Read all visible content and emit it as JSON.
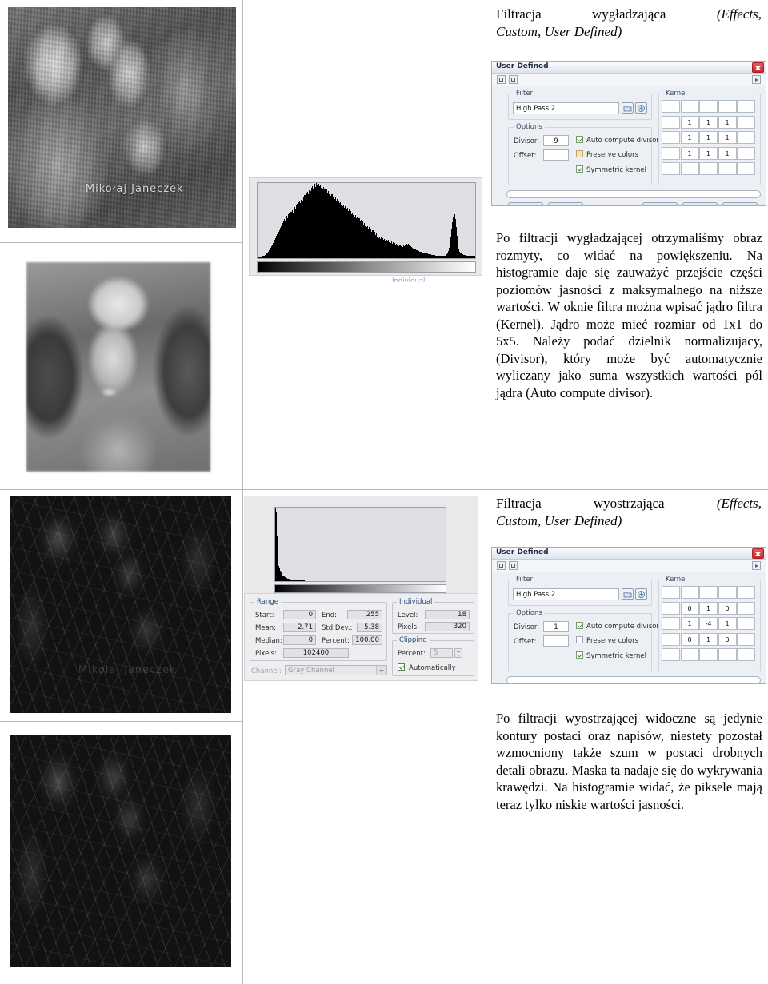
{
  "document": {
    "language": "pl",
    "watermark_text": "Mikołaj Janeczek"
  },
  "sections": [
    {
      "id": "smoothing",
      "heading_plain": "Filtracja wygładzająca",
      "heading_italic": "(Effects, Custom, User Defined)",
      "heading_part1": "Filtracja",
      "heading_part2": "wygładzająca",
      "heading_part3": "(Effects,",
      "heading_line2": "Custom, User Defined)",
      "body": "Po filtracji wygładzającej otrzymaliśmy obraz rozmyty, co widać na powiększeniu. Na histogramie daje się zauważyć przejście części poziomów jasności z maksymalnego na niższe wartości. W oknie filtra można wpisać jądro filtra (Kernel). Jądro może mieć rozmiar od 1x1 do 5x5. Należy podać dzielnik normalizujacy, (Divisor), który może być automatycznie wyliczany jako suma wszystkich wartości pól jądra (Auto compute divisor)."
    },
    {
      "id": "sharpening",
      "heading_part1": "Filtracja",
      "heading_part2": "wyostrzająca",
      "heading_part3": "(Effects,",
      "heading_line2": "Custom, User Defined)",
      "body": "Po filtracji wyostrzającej widoczne są jedynie kontury postaci oraz napisów, niestety pozostał wzmocniony także szum w postaci drobnych detali obrazu. Maska ta nadaje się do wykrywania krawędzi. Na histogramie widać, że piksele mają teraz tylko niskie wartości jasności."
    }
  ],
  "images": [
    {
      "id": "crowd-original",
      "caption": "",
      "watermark": "Mikołaj Janeczek",
      "kind": "grayscale-photo"
    },
    {
      "id": "face-blurred",
      "caption": "",
      "kind": "blurred-closeup"
    },
    {
      "id": "crowd-edges",
      "caption": "",
      "watermark": "Mikołaj Janeczek",
      "kind": "edge-detected"
    },
    {
      "id": "face-edges",
      "caption": "",
      "kind": "edge-detected"
    }
  ],
  "dialogs": [
    {
      "id": "user-defined-smoothing",
      "title": "User Defined",
      "close_label": "×",
      "filter_group_label": "Filter",
      "filter_value": "High Pass 2",
      "options_group_label": "Options",
      "divisor_label": "Divisor:",
      "divisor_value": "9",
      "offset_label": "Offset:",
      "offset_value": "",
      "checkboxes": [
        {
          "label": "Auto compute divisor",
          "checked": true,
          "style": "green"
        },
        {
          "label": "Preserve colors",
          "checked": false,
          "style": "tan"
        },
        {
          "label": "Symmetric kernel",
          "checked": true,
          "style": "green"
        }
      ],
      "kernel_group_label": "Kernel",
      "kernel_size": [
        5,
        5
      ],
      "kernel": [
        [
          "",
          "",
          "",
          "",
          ""
        ],
        [
          "",
          "1",
          "1",
          "1",
          ""
        ],
        [
          "",
          "1",
          "1",
          "1",
          ""
        ],
        [
          "",
          "1",
          "1",
          "1",
          ""
        ],
        [
          "",
          "",
          "",
          "",
          ""
        ]
      ]
    },
    {
      "id": "user-defined-sharpening",
      "title": "User Defined",
      "close_label": "×",
      "filter_group_label": "Filter",
      "filter_value": "High Pass 2",
      "options_group_label": "Options",
      "divisor_label": "Divisor:",
      "divisor_value": "1",
      "offset_label": "Offset:",
      "offset_value": "",
      "checkboxes": [
        {
          "label": "Auto compute divisor",
          "checked": true,
          "style": "green"
        },
        {
          "label": "Preserve colors",
          "checked": false,
          "style": "plain"
        },
        {
          "label": "Symmetric kernel",
          "checked": true,
          "style": "green"
        }
      ],
      "kernel_group_label": "Kernel",
      "kernel_size": [
        5,
        5
      ],
      "kernel": [
        [
          "",
          "",
          "",
          "",
          ""
        ],
        [
          "",
          "0",
          "1",
          "0",
          ""
        ],
        [
          "",
          "1",
          "-4",
          "1",
          ""
        ],
        [
          "",
          "0",
          "1",
          "0",
          ""
        ],
        [
          "",
          "",
          "",
          "",
          ""
        ]
      ]
    }
  ],
  "histogram_stats": {
    "range_group_label": "Range",
    "individual_group_label": "Individual",
    "clipping_group_label": "Clipping",
    "channel_label": "Channel:",
    "channel_value": "Gray Channel",
    "fields": {
      "start_label": "Start:",
      "start_value": "0",
      "end_label": "End:",
      "end_value": "255",
      "mean_label": "Mean:",
      "mean_value": "2.71",
      "stddev_label": "Std.Dev.:",
      "stddev_value": "5.38",
      "median_label": "Median:",
      "median_value": "0",
      "percent_label": "Percent:",
      "percent_value": "100.00",
      "pixels_label": "Pixels:",
      "pixels_value": "102400",
      "level_label": "Level:",
      "level_value": "18",
      "ind_pixels_label": "Pixels:",
      "ind_pixels_value": "320",
      "clip_percent_label": "Percent:",
      "clip_percent_value": "5",
      "automatically_label": "Automatically",
      "automatically_checked": true
    }
  },
  "partial_label_top": "Individual",
  "chart_data": [
    {
      "id": "histogram-smoothed",
      "type": "bar",
      "title": "",
      "xlabel": "",
      "ylabel": "",
      "xlim": [
        0,
        255
      ],
      "ylim": [
        0,
        1
      ],
      "grid": false,
      "legend": "none",
      "gradient_strip": true,
      "values": [
        0.01,
        0.01,
        0.01,
        0.02,
        0.02,
        0.02,
        0.03,
        0.03,
        0.04,
        0.05,
        0.06,
        0.07,
        0.09,
        0.11,
        0.12,
        0.14,
        0.16,
        0.18,
        0.2,
        0.22,
        0.25,
        0.27,
        0.3,
        0.32,
        0.35,
        0.37,
        0.4,
        0.43,
        0.45,
        0.47,
        0.49,
        0.52,
        0.5,
        0.54,
        0.56,
        0.53,
        0.58,
        0.6,
        0.57,
        0.62,
        0.64,
        0.61,
        0.66,
        0.68,
        0.65,
        0.7,
        0.72,
        0.69,
        0.74,
        0.76,
        0.73,
        0.78,
        0.8,
        0.77,
        0.82,
        0.84,
        0.81,
        0.86,
        0.88,
        0.85,
        0.9,
        0.92,
        0.89,
        0.94,
        0.96,
        0.93,
        0.97,
        0.99,
        0.95,
        1.0,
        0.97,
        0.99,
        0.96,
        0.98,
        0.94,
        0.97,
        0.93,
        0.95,
        0.91,
        0.93,
        0.89,
        0.91,
        0.87,
        0.89,
        0.85,
        0.87,
        0.83,
        0.85,
        0.81,
        0.83,
        0.79,
        0.81,
        0.77,
        0.79,
        0.75,
        0.77,
        0.73,
        0.75,
        0.71,
        0.73,
        0.69,
        0.71,
        0.67,
        0.69,
        0.65,
        0.67,
        0.63,
        0.65,
        0.61,
        0.63,
        0.59,
        0.61,
        0.57,
        0.59,
        0.55,
        0.57,
        0.53,
        0.55,
        0.51,
        0.53,
        0.49,
        0.51,
        0.47,
        0.49,
        0.45,
        0.47,
        0.43,
        0.45,
        0.41,
        0.43,
        0.39,
        0.41,
        0.37,
        0.39,
        0.35,
        0.37,
        0.33,
        0.35,
        0.31,
        0.33,
        0.29,
        0.31,
        0.27,
        0.29,
        0.26,
        0.28,
        0.25,
        0.27,
        0.24,
        0.26,
        0.23,
        0.25,
        0.22,
        0.24,
        0.21,
        0.23,
        0.2,
        0.22,
        0.19,
        0.21,
        0.18,
        0.2,
        0.17,
        0.19,
        0.17,
        0.18,
        0.16,
        0.18,
        0.16,
        0.17,
        0.15,
        0.17,
        0.16,
        0.18,
        0.17,
        0.19,
        0.18,
        0.19,
        0.18,
        0.17,
        0.16,
        0.15,
        0.14,
        0.13,
        0.12,
        0.12,
        0.11,
        0.11,
        0.1,
        0.1,
        0.09,
        0.09,
        0.08,
        0.08,
        0.07,
        0.07,
        0.07,
        0.06,
        0.06,
        0.06,
        0.05,
        0.05,
        0.05,
        0.05,
        0.04,
        0.04,
        0.04,
        0.04,
        0.04,
        0.03,
        0.03,
        0.03,
        0.03,
        0.03,
        0.03,
        0.03,
        0.03,
        0.03,
        0.03,
        0.03,
        0.03,
        0.04,
        0.05,
        0.07,
        0.1,
        0.14,
        0.2,
        0.28,
        0.38,
        0.48,
        0.55,
        0.58,
        0.52,
        0.42,
        0.3,
        0.2,
        0.13,
        0.09,
        0.07,
        0.06,
        0.05,
        0.05,
        0.04,
        0.04,
        0.04,
        0.03,
        0.03,
        0.03,
        0.03,
        0.03,
        0.03,
        0.03,
        0.03,
        0.03,
        0.03,
        0.03
      ]
    },
    {
      "id": "histogram-sharpened",
      "type": "bar",
      "title": "",
      "xlabel": "",
      "ylabel": "",
      "xlim": [
        0,
        255
      ],
      "ylim": [
        0,
        1
      ],
      "grid": false,
      "legend": "none",
      "gradient_strip": true,
      "values": [
        1.0,
        0.93,
        0.62,
        0.4,
        0.28,
        0.21,
        0.17,
        0.14,
        0.12,
        0.1,
        0.09,
        0.08,
        0.07,
        0.06,
        0.055,
        0.05,
        0.045,
        0.04,
        0.037,
        0.034,
        0.031,
        0.028,
        0.026,
        0.024,
        0.022,
        0.02,
        0.018,
        0.017,
        0.016,
        0.015,
        0.014,
        0.013,
        0.012,
        0.011,
        0.01,
        0.01,
        0.009,
        0.009,
        0.008,
        0.008,
        0.007,
        0.007,
        0.006,
        0.006,
        0.005,
        0.005,
        0.005,
        0.004,
        0.004,
        0.004,
        0.003,
        0.003,
        0.003,
        0.003,
        0.002,
        0.002,
        0.002,
        0.002,
        0.002,
        0.002,
        0.001,
        0.001,
        0.001,
        0.001,
        0.001,
        0.001,
        0.001,
        0.001,
        0.001,
        0.001,
        0,
        0,
        0,
        0,
        0,
        0,
        0,
        0,
        0,
        0,
        0,
        0,
        0,
        0,
        0,
        0,
        0,
        0,
        0,
        0,
        0,
        0,
        0,
        0,
        0,
        0,
        0,
        0,
        0,
        0,
        0,
        0,
        0,
        0,
        0,
        0,
        0,
        0,
        0,
        0,
        0,
        0,
        0,
        0,
        0,
        0,
        0,
        0,
        0,
        0,
        0,
        0,
        0,
        0,
        0,
        0,
        0,
        0,
        0,
        0,
        0,
        0,
        0,
        0,
        0,
        0,
        0,
        0,
        0,
        0,
        0,
        0,
        0,
        0,
        0,
        0,
        0,
        0,
        0,
        0,
        0,
        0,
        0,
        0,
        0,
        0,
        0,
        0,
        0,
        0,
        0,
        0,
        0,
        0,
        0,
        0,
        0,
        0,
        0,
        0,
        0,
        0,
        0,
        0,
        0,
        0,
        0,
        0,
        0,
        0,
        0,
        0,
        0,
        0,
        0,
        0,
        0,
        0,
        0,
        0,
        0,
        0,
        0,
        0,
        0,
        0,
        0,
        0,
        0,
        0,
        0,
        0,
        0,
        0,
        0,
        0,
        0,
        0,
        0,
        0,
        0,
        0,
        0,
        0,
        0,
        0,
        0,
        0,
        0,
        0,
        0,
        0,
        0,
        0,
        0,
        0,
        0,
        0,
        0,
        0,
        0,
        0,
        0,
        0,
        0,
        0,
        0,
        0,
        0,
        0,
        0,
        0,
        0,
        0,
        0,
        0,
        0,
        0,
        0,
        0,
        0,
        0,
        0,
        0,
        0,
        0
      ]
    }
  ]
}
